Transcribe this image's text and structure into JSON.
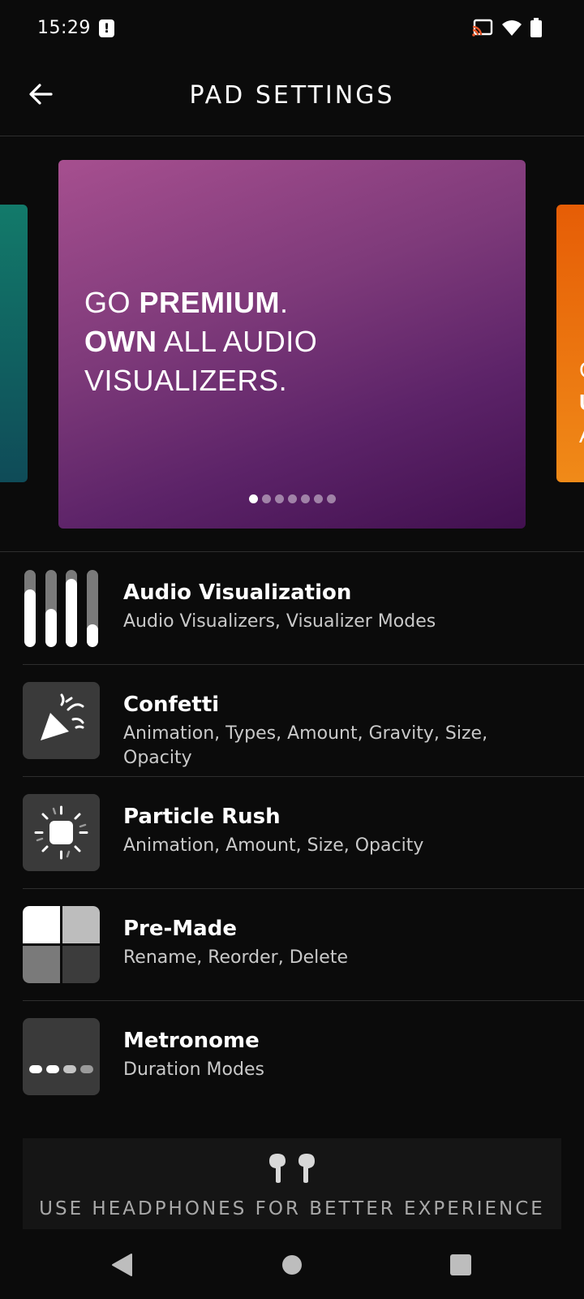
{
  "status_bar": {
    "time": "15:29"
  },
  "header": {
    "title": "PAD SETTINGS"
  },
  "carousel": {
    "headline_1_normal": "GO ",
    "headline_1_bold": "PREMIUM",
    "headline_1_end": ".",
    "headline_2_bold": "OWN",
    "headline_2_normal": " ALL AUDIO",
    "headline_3": "VISUALIZERS.",
    "dot_count": 7,
    "active_dot": 0,
    "right_card_letters": [
      "G",
      "U",
      "A"
    ]
  },
  "settings": [
    {
      "title": "Audio Visualization",
      "subtitle": "Audio Visualizers, Visualizer Modes"
    },
    {
      "title": "Confetti",
      "subtitle": "Animation, Types, Amount, Gravity, Size, Opacity"
    },
    {
      "title": "Particle Rush",
      "subtitle": "Animation, Amount, Size, Opacity"
    },
    {
      "title": "Pre-Made",
      "subtitle": "Rename, Reorder, Delete"
    },
    {
      "title": "Metronome",
      "subtitle": "Duration Modes"
    }
  ],
  "viz_levels": [
    0.75,
    0.5,
    0.88,
    0.3
  ],
  "headphones_banner": {
    "text": "USE HEADPHONES FOR BETTER EXPERIENCE"
  }
}
